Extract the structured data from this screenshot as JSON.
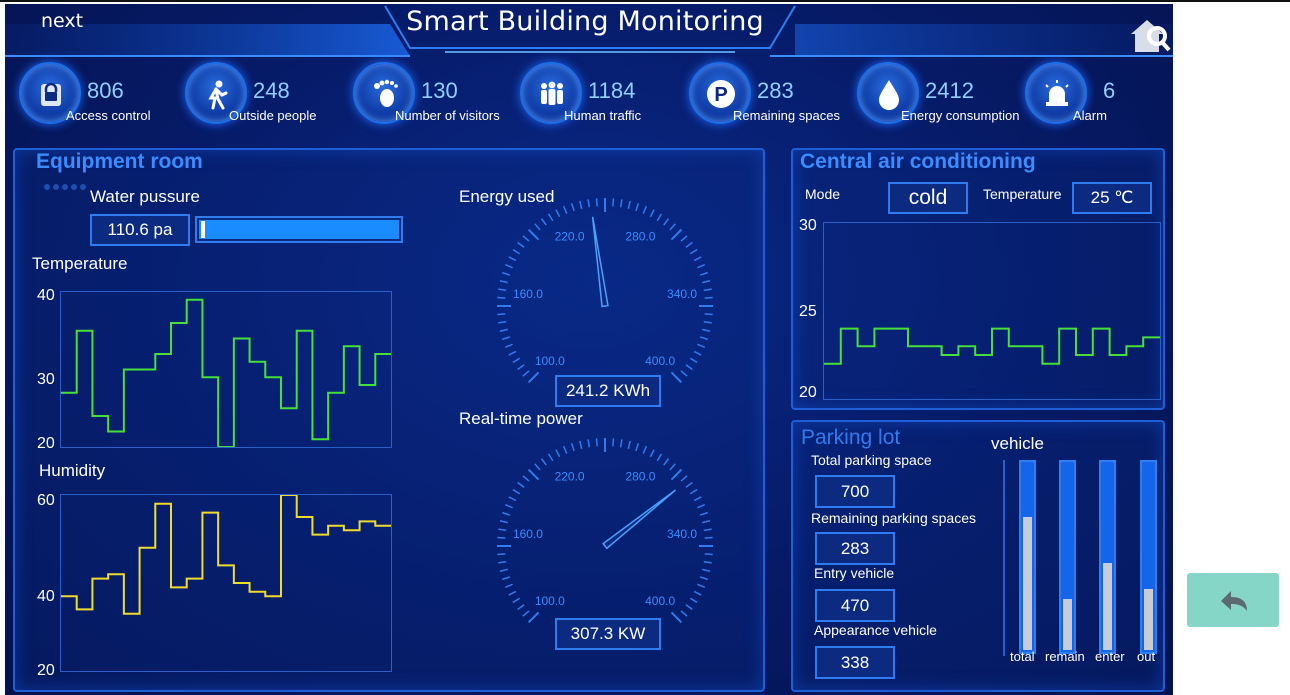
{
  "header": {
    "title": "Smart Building Monitoring",
    "next_label": "next"
  },
  "icons": {
    "home": "home-search-icon",
    "back": "back-arrow-icon"
  },
  "stats": [
    {
      "value": "806",
      "label": "Access control",
      "icon": "lock-icon"
    },
    {
      "value": "248",
      "label": "Outside people",
      "icon": "person-walking-icon"
    },
    {
      "value": "130",
      "label": "Number of visitors",
      "icon": "footprint-icon"
    },
    {
      "value": "1184",
      "label": "Human traffic",
      "icon": "people-group-icon"
    },
    {
      "value": "283",
      "label": "Remaining spaces",
      "icon": "parking-icon"
    },
    {
      "value": "2412",
      "label": "Energy consumption",
      "icon": "water-drop-icon"
    },
    {
      "value": "6",
      "label": "Alarm",
      "icon": "alarm-siren-icon"
    }
  ],
  "equipment": {
    "title": "Equipment room",
    "water_pressure": {
      "label": "Water pussure",
      "value": "110.6 pa",
      "fill": 1.0
    },
    "temperature": {
      "label": "Temperature",
      "ticks": [
        "40",
        "30",
        "20"
      ],
      "ylim": [
        20,
        40
      ]
    },
    "humidity": {
      "label": "Humidity",
      "ticks": [
        "60",
        "40",
        "20"
      ],
      "ylim": [
        20,
        60
      ]
    },
    "energy_used": {
      "label": "Energy used",
      "value": "241.2 KWh",
      "ticks": [
        "100.0",
        "160.0",
        "220.0",
        "280.0",
        "340.0",
        "400.0"
      ],
      "needle": 241.2,
      "min": 100,
      "max": 400
    },
    "realtime_power": {
      "label": "Real-time power",
      "value": "307.3 KW",
      "ticks": [
        "100.0",
        "160.0",
        "220.0",
        "280.0",
        "340.0",
        "400.0"
      ],
      "needle": 307.3,
      "min": 100,
      "max": 400
    }
  },
  "aircon": {
    "title": "Central air conditioning",
    "mode_label": "Mode",
    "mode_value": "cold",
    "temp_label": "Temperature",
    "temp_value": "25 ℃",
    "ticks": [
      "30",
      "25",
      "20"
    ],
    "ylim": [
      20,
      30
    ]
  },
  "parking": {
    "title": "Parking lot",
    "vehicle_label": "vehicle",
    "fields": [
      {
        "label": "Total parking space",
        "value": "700"
      },
      {
        "label": "Remaining parking spaces",
        "value": "283"
      },
      {
        "label": "Entry vehicle",
        "value": "470"
      },
      {
        "label": "Appearance vehicle",
        "value": "338"
      }
    ],
    "bars": [
      {
        "label": "total",
        "fraction": 0.72
      },
      {
        "label": "remain",
        "fraction": 0.29
      },
      {
        "label": "enter",
        "fraction": 0.48
      },
      {
        "label": "out",
        "fraction": 0.34
      }
    ]
  },
  "chart_data": [
    {
      "type": "line",
      "title": "Temperature",
      "ylim": [
        20,
        40
      ],
      "x": [
        0,
        1,
        2,
        3,
        4,
        5,
        6,
        7,
        8,
        9,
        10,
        11,
        12,
        13,
        14,
        15,
        16,
        17,
        18,
        19,
        20
      ],
      "values": [
        27,
        35,
        24,
        22,
        30,
        30,
        32,
        36,
        39,
        29,
        20,
        34,
        31,
        29,
        25,
        35,
        21,
        27,
        33,
        28,
        32
      ]
    },
    {
      "type": "line",
      "title": "Humidity",
      "ylim": [
        20,
        60
      ],
      "x": [
        0,
        1,
        2,
        3,
        4,
        5,
        6,
        7,
        8,
        9,
        10,
        11,
        12,
        13,
        14,
        15,
        16,
        17,
        18,
        19,
        20
      ],
      "values": [
        37,
        34,
        41,
        42,
        33,
        48,
        58,
        39,
        41,
        56,
        44,
        40,
        38,
        37,
        60,
        55,
        51,
        53,
        52,
        54,
        53
      ]
    },
    {
      "type": "line",
      "title": "Central air conditioning",
      "ylim": [
        20,
        30
      ],
      "x": [
        0,
        1,
        2,
        3,
        4,
        5,
        6,
        7,
        8,
        9,
        10,
        11,
        12,
        13,
        14,
        15,
        16,
        17,
        18,
        19
      ],
      "values": [
        22,
        24,
        23,
        24,
        24,
        23,
        23,
        22.5,
        23,
        22.5,
        24,
        23,
        23,
        22,
        24,
        22.5,
        24,
        22.5,
        23,
        23.5
      ]
    }
  ]
}
